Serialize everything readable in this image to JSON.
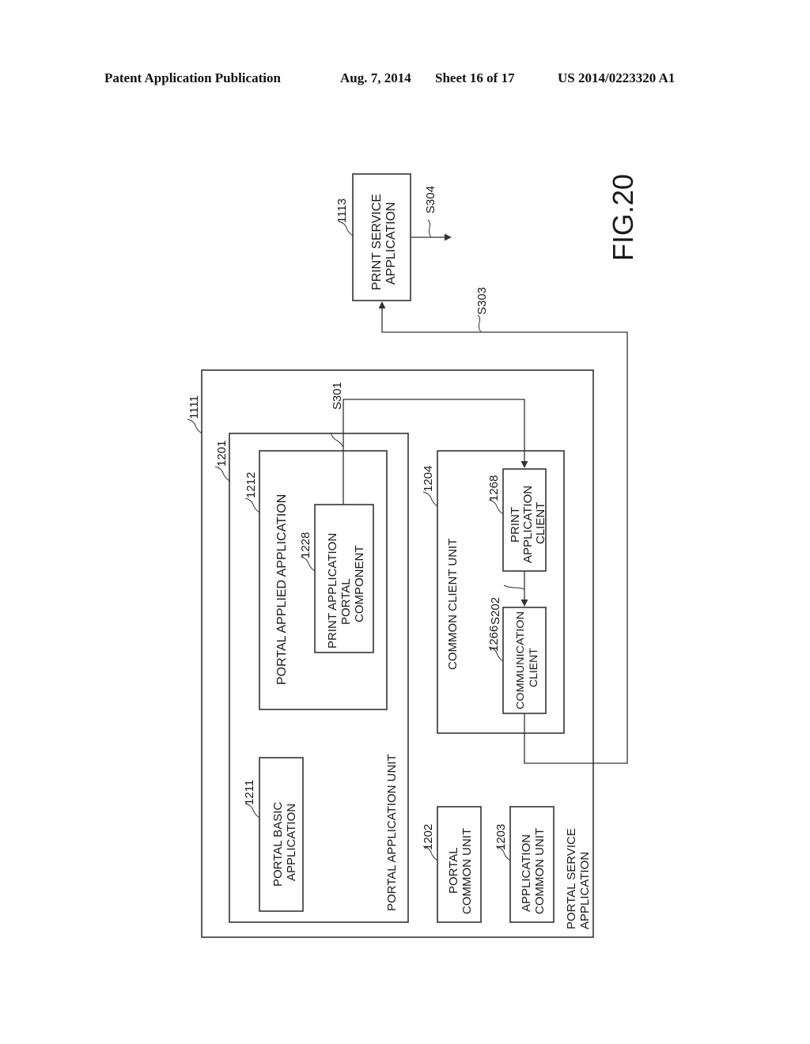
{
  "header": {
    "publication": "Patent Application Publication",
    "date": "Aug. 7, 2014",
    "sheet": "Sheet 16 of 17",
    "patent_number": "US 2014/0223320 A1"
  },
  "figure": {
    "label": "FIG.20",
    "orientation": "rotated 90 degrees counter-clockwise"
  },
  "blocks": {
    "portal_service_app": {
      "ref": "1111",
      "lines": [
        "PORTAL SERVICE",
        "APPLICATION"
      ]
    },
    "portal_app_unit": {
      "ref": "1201",
      "lines": [
        "PORTAL APPLICATION UNIT"
      ]
    },
    "portal_applied_app": {
      "ref": "1212",
      "lines": [
        "PORTAL APPLIED APPLICATION"
      ]
    },
    "print_app_portal_component": {
      "ref": "1228",
      "lines": [
        "PRINT APPLICATION",
        "PORTAL",
        "COMPONENT"
      ]
    },
    "portal_basic_app": {
      "ref": "1211",
      "lines": [
        "PORTAL BASIC",
        "APPLICATION"
      ]
    },
    "common_client_unit": {
      "ref": "1204",
      "lines": [
        "COMMON CLIENT UNIT"
      ]
    },
    "print_app_client": {
      "ref": "1268",
      "lines": [
        "PRINT",
        "APPLICATION",
        "CLIENT"
      ]
    },
    "communication_client": {
      "ref": "1266",
      "lines": [
        "COMMUNICATION",
        "CLIENT"
      ]
    },
    "portal_common_unit": {
      "ref": "1202",
      "lines": [
        "PORTAL",
        "COMMON UNIT"
      ]
    },
    "app_common_unit": {
      "ref": "1203",
      "lines": [
        "APPLICATION",
        "COMMON UNIT"
      ]
    },
    "print_service_app": {
      "ref": "1113",
      "lines": [
        "PRINT SERVICE",
        "APPLICATION"
      ]
    }
  },
  "steps": {
    "s301": "S301",
    "s202": "S202",
    "s303": "S303",
    "s304": "S304"
  },
  "colors": {
    "ink": "#333333",
    "background": "#ffffff"
  }
}
